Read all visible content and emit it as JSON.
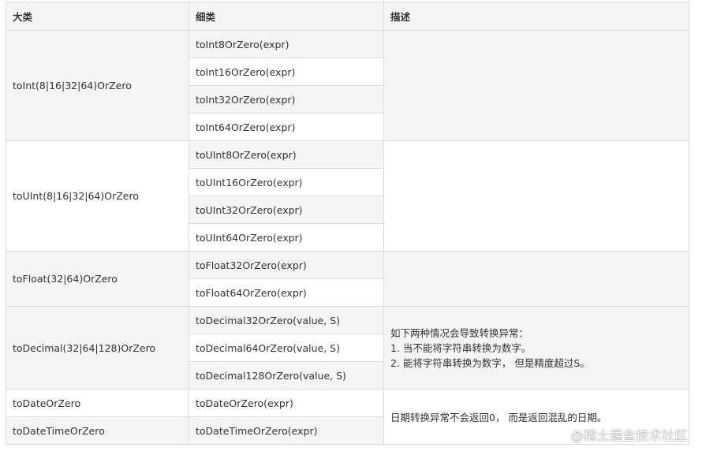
{
  "headers": {
    "category": "大类",
    "subcategory": "细类",
    "description": "描述"
  },
  "groups": [
    {
      "category": "toInt(8|16|32|64)OrZero",
      "functions": [
        "toInt8OrZero(expr)",
        "toInt16OrZero(expr)",
        "toInt32OrZero(expr)",
        "toInt64OrZero(expr)"
      ]
    },
    {
      "category": "toUInt(8|16|32|64)OrZero",
      "functions": [
        "toUInt8OrZero(expr)",
        "toUInt16OrZero(expr)",
        "toUInt32OrZero(expr)",
        "toUInt64OrZero(expr)"
      ]
    },
    {
      "category": "toFloat(32|64)OrZero",
      "functions": [
        "toFloat32OrZero(expr)",
        "toFloat64OrZero(expr)"
      ]
    },
    {
      "category": "toDecimal(32|64|128)OrZero",
      "functions": [
        "toDecimal32OrZero(value, S)",
        "toDecimal64OrZero(value, S)",
        "toDecimal128OrZero(value, S)"
      ]
    },
    {
      "category": "toDateOrZero",
      "functions": [
        "toDateOrZero(expr)"
      ]
    },
    {
      "category": "toDateTimeOrZero",
      "functions": [
        "toDateTimeOrZero(expr)"
      ]
    }
  ],
  "descriptions": {
    "decimal": [
      "如下两种情况会导致转换异常：",
      "1. 当不能将字符串转换为数字。",
      "2. 能将字符串转换为数字， 但是精度超过S。"
    ],
    "date": "日期转换异常不会返回0， 而是返回混乱的日期。"
  },
  "watermark": "@稀土掘金技术社区"
}
